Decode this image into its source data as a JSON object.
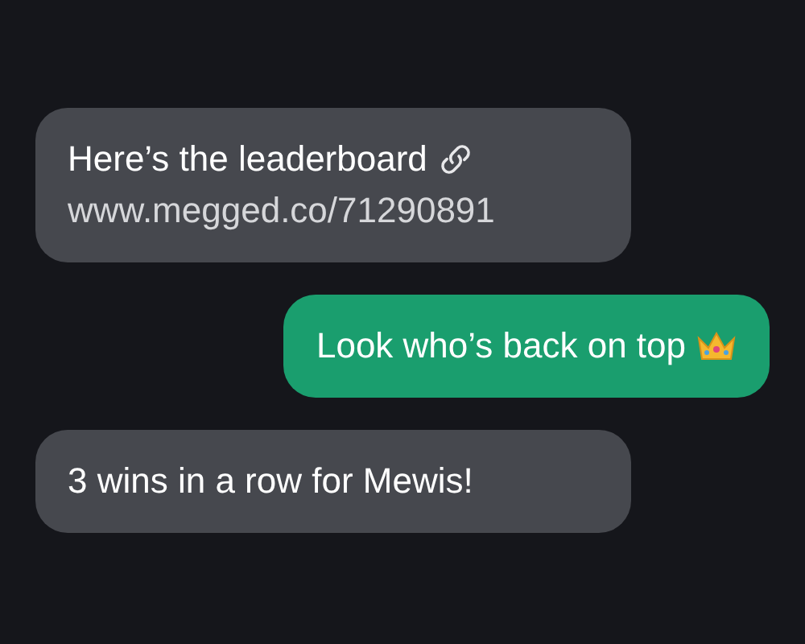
{
  "messages": [
    {
      "kind": "incoming",
      "text": "Here’s the leaderboard",
      "icon": {
        "kind": "link"
      },
      "link": "www.megged.co/71290891"
    },
    {
      "kind": "outgoing",
      "text": "Look who’s back on top",
      "icon": {
        "kind": "crown"
      }
    },
    {
      "kind": "incoming",
      "text": "3 wins in a row for Mewis!"
    }
  ]
}
